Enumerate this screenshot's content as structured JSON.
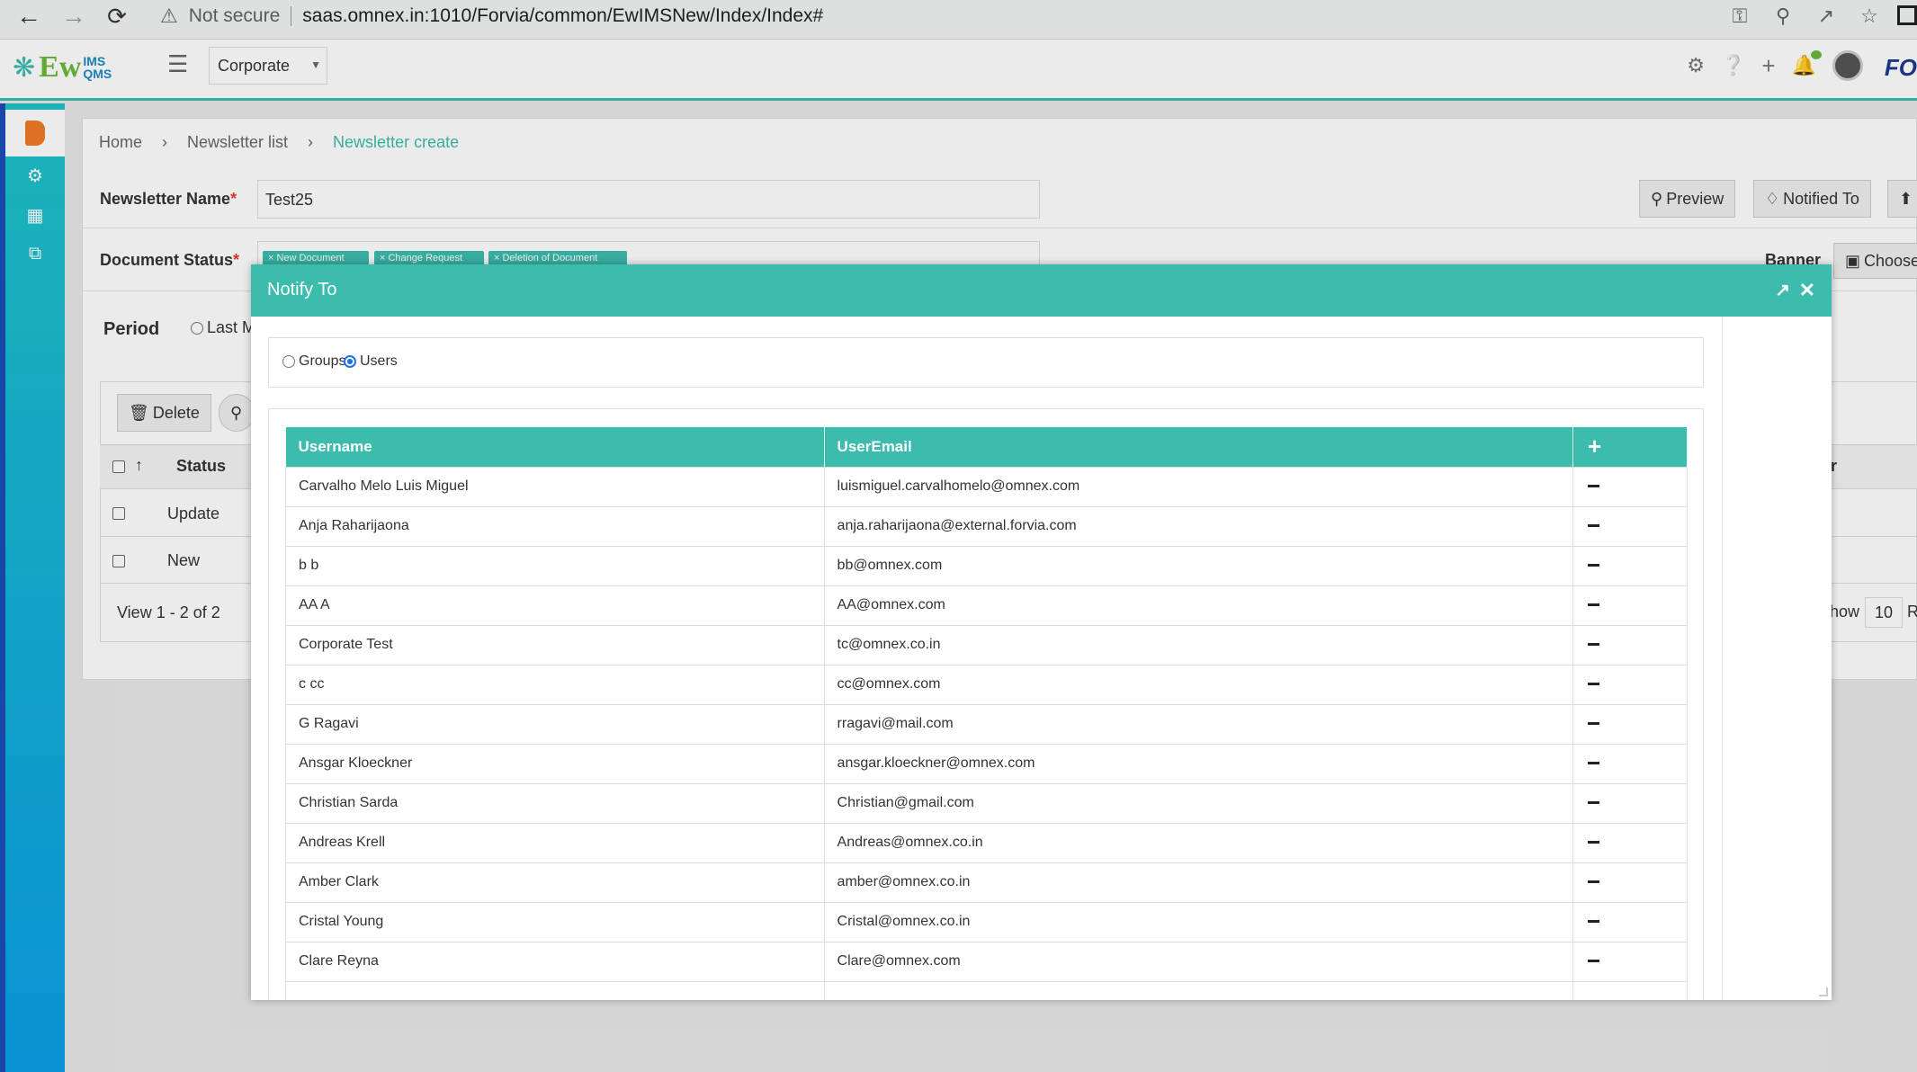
{
  "browser": {
    "security": "Not secure",
    "url": "saas.omnex.in:1010/Forvia/common/EwIMSNew/Index/Index#"
  },
  "header": {
    "logo_main": "Ew",
    "logo_sup": "IMS",
    "logo_sub": "QMS",
    "org_selector": "Corporate",
    "brand": "FO"
  },
  "breadcrumb": [
    "Home",
    "Newsletter list",
    "Newsletter create"
  ],
  "form": {
    "name_label": "Newsletter Name",
    "name_value": "Test25",
    "status_label": "Document Status",
    "status_tags": [
      "× New Document",
      "× Change Request",
      "× Deletion of Document"
    ],
    "banner_label": "Banner",
    "choose_label": "Choose",
    "period_label": "Period",
    "period_option": "Last M",
    "preview_label": "Preview",
    "notified_label": "Notified To"
  },
  "grid": {
    "delete_label": "Delete",
    "status_header": "Status",
    "col_right": "r",
    "rows": [
      "Update",
      "New"
    ],
    "footer": "View 1 - 2 of 2",
    "show_label": "how",
    "page_size": "10",
    "right_trunc": "R"
  },
  "modal": {
    "title": "Notify To",
    "radio_groups": "Groups",
    "radio_users": "Users",
    "col_username": "Username",
    "col_email": "UserEmail",
    "users": [
      {
        "name": "Carvalho Melo Luis Miguel",
        "email": "luismiguel.carvalhomelo@omnex.com"
      },
      {
        "name": "Anja Raharijaona",
        "email": "anja.raharijaona@external.forvia.com"
      },
      {
        "name": "b b",
        "email": "bb@omnex.com"
      },
      {
        "name": "AA A",
        "email": "AA@omnex.com"
      },
      {
        "name": "Corporate Test",
        "email": "tc@omnex.co.in"
      },
      {
        "name": "c cc",
        "email": "cc@omnex.com"
      },
      {
        "name": "G Ragavi",
        "email": "rragavi@mail.com"
      },
      {
        "name": "Ansgar Kloeckner",
        "email": "ansgar.kloeckner@omnex.com"
      },
      {
        "name": "Christian Sarda",
        "email": "Christian@gmail.com"
      },
      {
        "name": "Andreas Krell",
        "email": "Andreas@omnex.co.in"
      },
      {
        "name": "Amber Clark",
        "email": "amber@omnex.co.in"
      },
      {
        "name": "Cristal Young",
        "email": "Cristal@omnex.co.in"
      },
      {
        "name": "Clare Reyna",
        "email": "Clare@omnex.com"
      },
      {
        "name": "",
        "email": ""
      }
    ]
  }
}
